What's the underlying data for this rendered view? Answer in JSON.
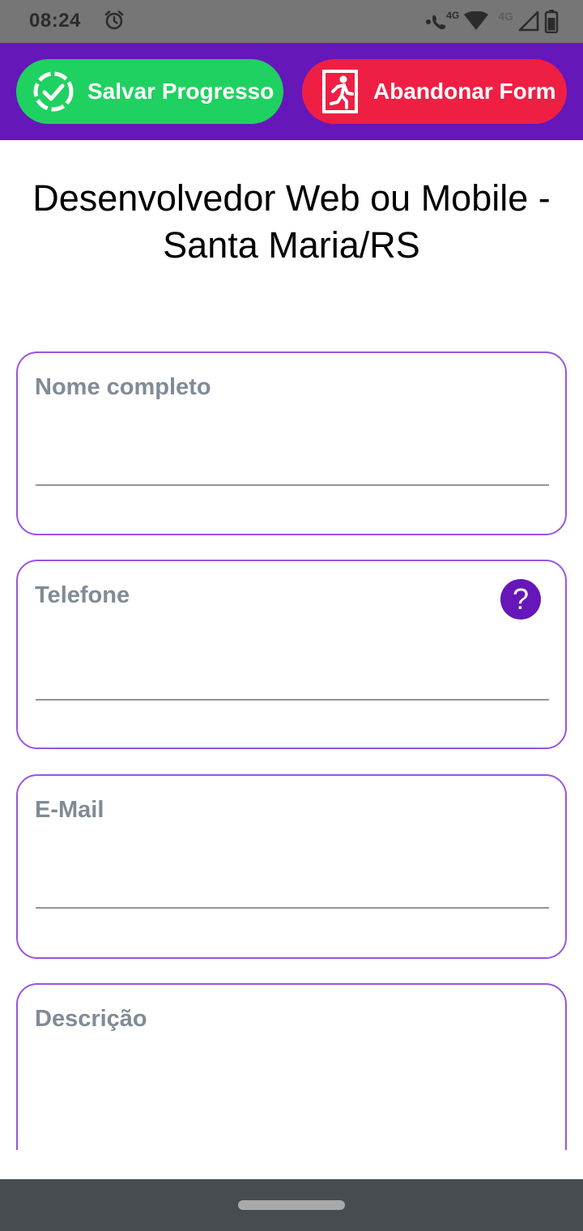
{
  "status_bar": {
    "time": "08:24",
    "icons": [
      "alarm-icon",
      "wifi-call-icon",
      "wifi-icon",
      "mobile-signal-icon",
      "battery-icon"
    ],
    "network_label_1": "4G",
    "network_label_2": "4G"
  },
  "action_bar": {
    "save_label": "Salvar Progresso",
    "abandon_label": "Abandonar Form",
    "save_color": "#1fd160",
    "abandon_color": "#ef1f43",
    "background": "#6517b9"
  },
  "page": {
    "title_line_1": "Desenvolvedor Web ou Mobile -",
    "title_line_2": "Santa Maria/RS"
  },
  "form": {
    "fields": [
      {
        "label": "Nome completo",
        "value": ""
      },
      {
        "label": "Telefone",
        "value": "",
        "help": "?"
      },
      {
        "label": "E-Mail",
        "value": ""
      },
      {
        "label": "Descrição",
        "value": ""
      }
    ],
    "border_color": "#9c54e0",
    "label_color": "#818b96"
  }
}
